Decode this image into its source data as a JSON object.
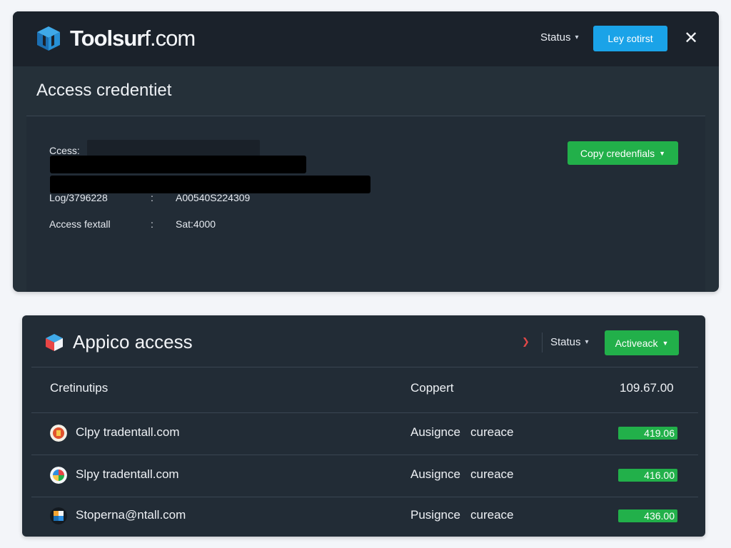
{
  "header": {
    "brand_name": "Toolsur",
    "brand_tld": "f.com",
    "status_label": "Status",
    "cta_label": "Ley ɛotirst",
    "close_glyph": "✕"
  },
  "credentials": {
    "title": "Access credentiet",
    "fields": [
      {
        "label": "Ccess:",
        "value": ""
      },
      {
        "label": "Log/3796228",
        "value": "A00540S224309"
      },
      {
        "label": "Access fextall",
        "value": "Sat:4000"
      }
    ],
    "colon": ":",
    "copy_label": "Copy credenfials"
  },
  "app_access": {
    "title": "Appico access",
    "status_label": "Status",
    "active_label": "Activeack",
    "columns": {
      "name": "Cretinutips",
      "type": "Coppert",
      "amount": "109.67.00"
    },
    "rows": [
      {
        "email": "Clpy tradentall.com",
        "type": "Ausignce",
        "sub": "cureace",
        "amount": "419.06",
        "icon": "red-badge-icon"
      },
      {
        "email": "Slpy tradentall.com",
        "type": "Ausignce",
        "sub": "cureace",
        "amount": "416.00",
        "icon": "google-icon"
      },
      {
        "email": "Stoperna@ntall.com",
        "type": "Pusignce",
        "sub": "cureace",
        "amount": "436.00",
        "icon": "puzzle-icon"
      }
    ]
  },
  "colors": {
    "panel_bg": "#253039",
    "topbar_bg": "#1b222b",
    "cta_blue": "#1aa3e8",
    "success_green": "#22b04a",
    "alert_red": "#e04848"
  }
}
